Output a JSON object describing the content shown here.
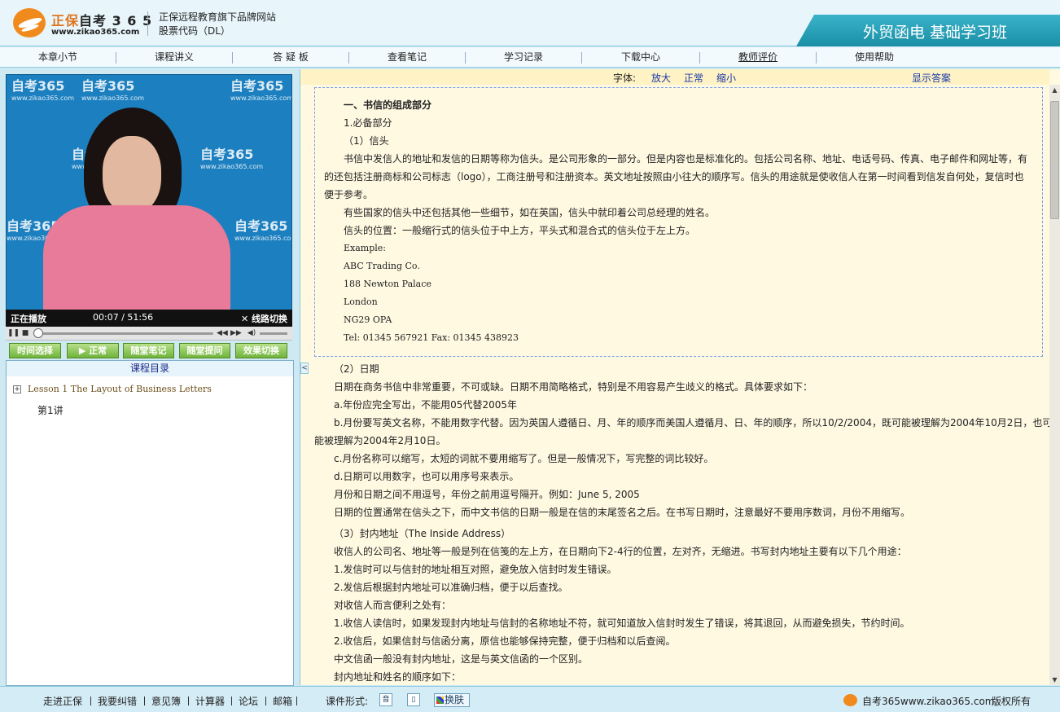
{
  "header": {
    "brand_cn": "正保",
    "brand_name": "自考 3 6 5",
    "brand_url": "www.zikao365.com",
    "slogan_line1": "正保远程教育旗下品牌网站",
    "slogan_line2": "股票代码（DL）",
    "course_title": "外贸函电 基础学习班"
  },
  "nav": {
    "items": [
      "本章小节",
      "课程讲义",
      "答 疑 板",
      "查看笔记",
      "学习记录",
      "下载中心",
      "教师评价",
      "使用帮助"
    ]
  },
  "video": {
    "status_label": "正在播放",
    "time": "00:07  /  51:56",
    "mode_label": "线路切换",
    "watermark": "自考365",
    "watermark_url": "www.zikao365.com",
    "progress": 0.002
  },
  "video_buttons": [
    "时间选择",
    "▶ 正常",
    "随堂笔记",
    "随堂提问",
    "效果切换"
  ],
  "toc": {
    "title": "课程目录",
    "lesson": "Lesson 1  The Layout of Business Letters",
    "sub_item": "第1讲"
  },
  "font_bar": {
    "label": "字体:",
    "larger": "放大",
    "normal": "正常",
    "smaller": "缩小",
    "show_answer": "显示答案"
  },
  "content": {
    "boxed": [
      "一、书信的组成部分",
      "1.必备部分",
      "（1）信头",
      "书信中发信人的地址和发信的日期等称为信头。是公司形象的一部分。但是内容也是标准化的。包括公司名称、地址、电话号码、传真、电子邮件和网址等，有",
      "的还包括注册商标和公司标志（logo），工商注册号和注册资本。英文地址按照由小往大的顺序写。信头的用途就是使收信人在第一时间看到信发自何处，复信时也",
      "便于参考。",
      "有些国家的信头中还包括其他一些细节，如在英国，信头中就印着公司总经理的姓名。",
      "信头的位置：一般缩行式的信头位于中上方，平头式和混合式的信头位于左上方。",
      "Example:",
      "ABC Trading Co.",
      "188 Newton Palace",
      "London",
      "NG29 OPA",
      "Tel: 01345 567921 Fax: 01345 438923"
    ],
    "body": [
      "（2）日期",
      "日期在商务书信中非常重要，不可或缺。日期不用简略格式，特别是不用容易产生歧义的格式。具体要求如下：",
      "a.年份应完全写出，不能用05代替2005年",
      "b.月份要写英文名称，不能用数字代替。因为英国人遵循日、月、年的顺序而美国人遵循月、日、年的顺序，所以10/2/2004，既可能被理解为2004年10月2日，也可",
      "能被理解为2004年2月10日。",
      "c.月份名称可以缩写，太短的词就不要用缩写了。但是一般情况下，写完整的词比较好。",
      "d.日期可以用数字，也可以用序号来表示。",
      "月份和日期之间不用逗号，年份之前用逗号隔开。例如：June 5, 2005",
      "日期的位置通常在信头之下，而中文书信的日期一般是在信的末尾签名之后。在书写日期时，注意最好不要用序数词，月份不用缩写。",
      "（3）封内地址（The Inside Address）",
      "收信人的公司名、地址等一般是列在信笺的左上方，在日期向下2-4行的位置，左对齐，无缩进。书写封内地址主要有以下几个用途：",
      "1.发信时可以与信封的地址相互对照，避免放入信封时发生错误。",
      "2.发信后根据封内地址可以准确归档，便于以后查找。",
      "对收信人而言便利之处有：",
      "1.收信人读信时，如果发现封内地址与信封的名称地址不符，就可知道放入信封时发生了错误，将其退回，从而避免损失，节约时间。",
      "2.收信后，如果信封与信函分离，原信也能够保持完整，便于归档和以后查阅。",
      "中文信函一般没有封内地址，这是与英文信函的一个区别。",
      "封内地址和姓名的顺序如下："
    ]
  },
  "footer": {
    "links": [
      "走进正保",
      "我要纠错",
      "意见簿",
      "计算器",
      "论坛",
      "邮箱"
    ],
    "format_label": "课件形式:",
    "audio_icon": "音",
    "skin_label": "换肤",
    "site": "自考365www.zikao365.com",
    "rights": "版权所有"
  },
  "colors": {
    "banner": "#1a8fa6",
    "link": "#1a3aa8",
    "content_bg": "#fff9e2",
    "button_green": "#6fb33a"
  }
}
